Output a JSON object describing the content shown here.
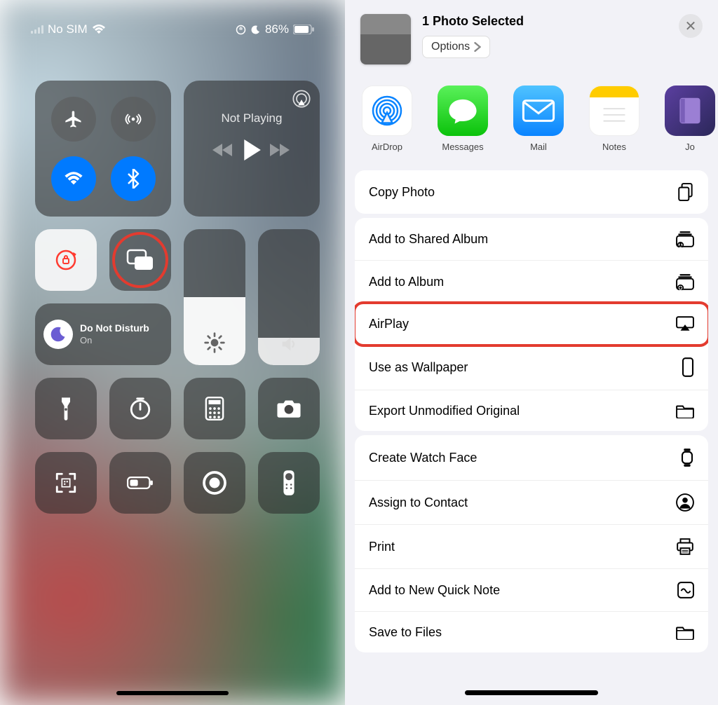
{
  "statusbar": {
    "sim": "No SIM",
    "battery": "86%"
  },
  "controlCenter": {
    "media": {
      "nowPlaying": "Not Playing"
    },
    "focus": {
      "title": "Do Not Disturb",
      "state": "On"
    }
  },
  "shareSheet": {
    "headerTitle": "1 Photo Selected",
    "optionsLabel": "Options",
    "apps": {
      "airdrop": "AirDrop",
      "messages": "Messages",
      "mail": "Mail",
      "notes": "Notes",
      "other": "Jo"
    },
    "actions": {
      "copyPhoto": "Copy Photo",
      "addShared": "Add to Shared Album",
      "addAlbum": "Add to Album",
      "airplay": "AirPlay",
      "wallpaper": "Use as Wallpaper",
      "exportOrig": "Export Unmodified Original",
      "watchFace": "Create Watch Face",
      "assignContact": "Assign to Contact",
      "print": "Print",
      "quickNote": "Add to New Quick Note",
      "saveFiles": "Save to Files"
    }
  }
}
